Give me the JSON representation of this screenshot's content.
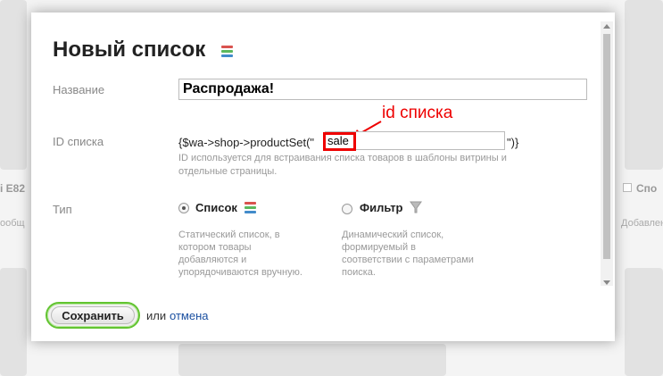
{
  "background": {
    "left_title": "i E82",
    "right_title": "Спо",
    "left_note": "ообщ",
    "right_note": "Добавлен"
  },
  "dialog": {
    "title": "Новый список",
    "fields": {
      "name_label": "Название",
      "name_value": "Распродажа!",
      "id_label": "ID списка",
      "code_prefix": "{$wa->shop->productSet(\"",
      "id_value": "sale",
      "code_suffix": "\")}",
      "id_hint": "ID используется для встраивания списка товаров в шаблоны витрины и отдельные страницы.",
      "type_label": "Тип"
    },
    "annotation": "id списка",
    "types": [
      {
        "label": "Список",
        "selected": true,
        "description": "Статический список, в котором товары добавляются и упорядочиваются вручную."
      },
      {
        "label": "Фильтр",
        "selected": false,
        "description": "Динамический список, формируемый в соответствии с параметрами поиска."
      }
    ],
    "footer": {
      "save_label": "Сохранить",
      "or_text": "или",
      "cancel_label": "отмена"
    }
  },
  "colors": {
    "accent_green": "#62c431",
    "annotation_red": "#e00000",
    "link_blue": "#1a4fa0"
  }
}
